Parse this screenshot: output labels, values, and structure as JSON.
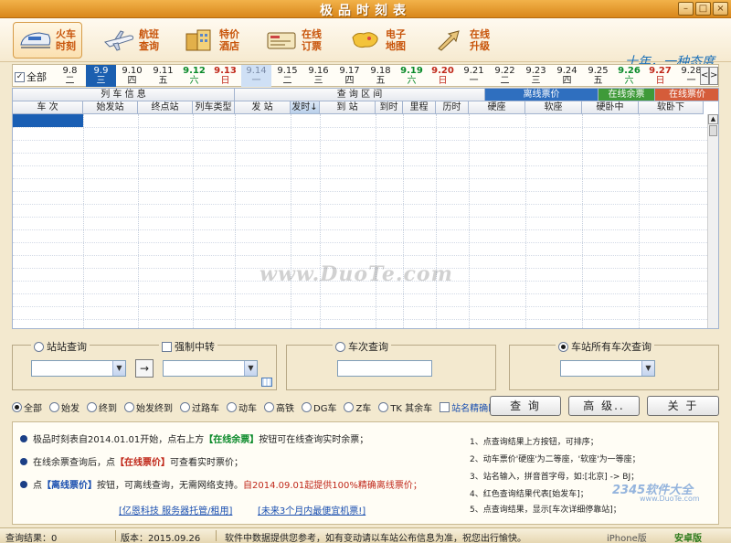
{
  "window": {
    "title": "极品时刻表",
    "minimize": "–",
    "maximize": "□",
    "close": "×"
  },
  "toolbar": {
    "items": [
      {
        "line1": "火车",
        "line2": "时刻"
      },
      {
        "line1": "航班",
        "line2": "查询"
      },
      {
        "line1": "特价",
        "line2": "酒店"
      },
      {
        "line1": "在线",
        "line2": "订票"
      },
      {
        "line1": "电子",
        "line2": "地图"
      },
      {
        "line1": "在线",
        "line2": "升级"
      }
    ],
    "slogan": "十年，一种态度"
  },
  "datebar": {
    "all_label": "全部",
    "days": [
      {
        "d": "9.8",
        "w": "二"
      },
      {
        "d": "9.9",
        "w": "三"
      },
      {
        "d": "9.10",
        "w": "四"
      },
      {
        "d": "9.11",
        "w": "五"
      },
      {
        "d": "9.12",
        "w": "六"
      },
      {
        "d": "9.13",
        "w": "日"
      },
      {
        "d": "9.14",
        "w": "一"
      },
      {
        "d": "9.15",
        "w": "二"
      },
      {
        "d": "9.16",
        "w": "三"
      },
      {
        "d": "9.17",
        "w": "四"
      },
      {
        "d": "9.18",
        "w": "五"
      },
      {
        "d": "9.19",
        "w": "六"
      },
      {
        "d": "9.20",
        "w": "日"
      },
      {
        "d": "9.21",
        "w": "一"
      },
      {
        "d": "9.22",
        "w": "二"
      },
      {
        "d": "9.23",
        "w": "三"
      },
      {
        "d": "9.24",
        "w": "四"
      },
      {
        "d": "9.25",
        "w": "五"
      },
      {
        "d": "9.26",
        "w": "六"
      },
      {
        "d": "9.27",
        "w": "日"
      },
      {
        "d": "9.28",
        "w": "一"
      }
    ],
    "prev": "<",
    "next": ">"
  },
  "grid": {
    "group1": "列 车 信 息",
    "group2": "查 询 区 间",
    "group3": "离线票价",
    "group4": "在线余票",
    "group5": "在线票价",
    "columns": [
      "车 次",
      "始发站",
      "终点站",
      "列车类型",
      "发 站",
      "发时↓",
      "到 站",
      "到时",
      "里程",
      "历时",
      "硬座",
      "软座",
      "硬卧中",
      "软卧下"
    ]
  },
  "watermark": "www.DuoTe.com",
  "query": {
    "station_to_station": "站站查询",
    "force_transfer": "强制中转",
    "arrow": "→",
    "train_query": "车次查询",
    "station_all": "车站所有车次查询",
    "combo_arrow": "▼"
  },
  "filters": {
    "items": [
      "全部",
      "始发",
      "终到",
      "始发终到",
      "过路车",
      "动车",
      "高铁",
      "DG车",
      "Z车",
      "TK 其余车"
    ],
    "exact_match": "站名精确匹配"
  },
  "buttons": {
    "query": "查 询",
    "advanced": "高 级..",
    "about": "关 于"
  },
  "info": {
    "n1a": "极品时刻表自2014.01.01开始，点右上方",
    "n1b": "【在线余票】",
    "n1c": "按钮可在线查询实时余票；",
    "n2a": "在线余票查询后，点",
    "n2b": "【在线票价】",
    "n2c": "可查看实时票价；",
    "n3a": "点",
    "n3b": "【离线票价】",
    "n3c": "按钮，可离线查询，无需网络支持。",
    "n3d": "自2014.09.01起提供100%精确离线票价；",
    "link1": "[亿恩科技 服务器托管/租用]",
    "link2": "[未来3个月内最便宜机票!]",
    "tips": [
      "1、点查询结果上方按钮，可排序；",
      "2、动车票价'硬座'为二等座，'软座'为一等座；",
      "3、站名输入，拼音首字母，如:[北京] -> BJ；",
      "4、红色查询结果代表[始发车]；",
      "5、点查询结果，显示[车次详细停靠站]；"
    ],
    "wm_brand": "2345软件大全",
    "wm_site": "www.DuoTe.com"
  },
  "status": {
    "result": "查询结果：0",
    "version": "版本：2015.09.26",
    "notice": "软件中数据提供您参考，如有变动请以车站公布信息为准，祝您出行愉快。",
    "iphone": "iPhone版",
    "android": "安卓版"
  }
}
